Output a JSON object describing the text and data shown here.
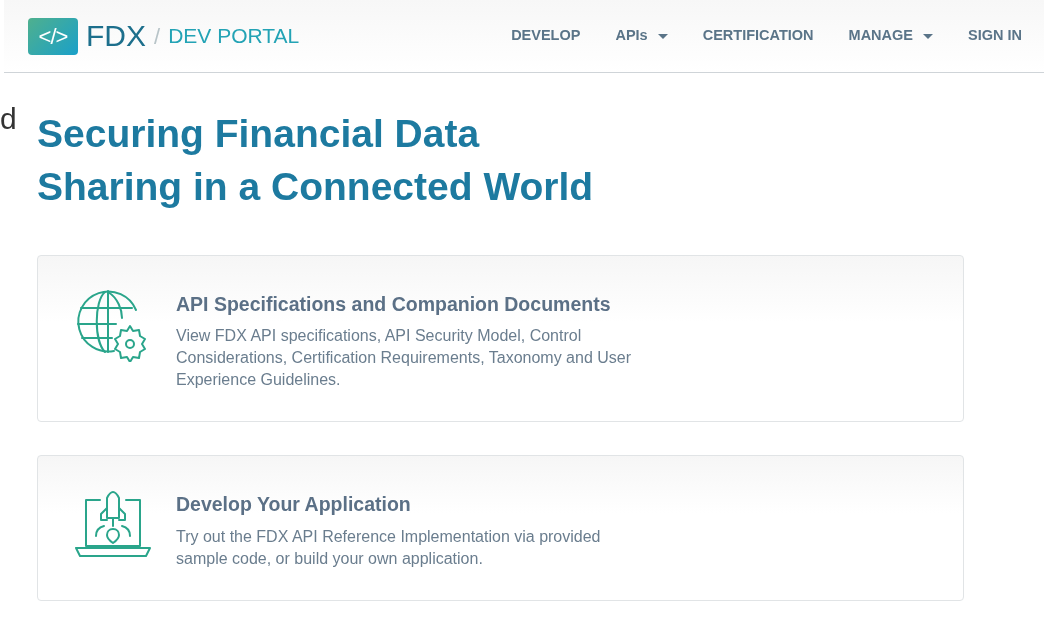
{
  "header": {
    "brand": "FDX",
    "separator": "/",
    "portal": "DEV PORTAL",
    "logo_glyph": "</>",
    "nav": [
      {
        "label": "DEVELOP",
        "dropdown": false
      },
      {
        "label": "APIs",
        "dropdown": true
      },
      {
        "label": "CERTIFICATION",
        "dropdown": false
      },
      {
        "label": "MANAGE",
        "dropdown": true
      },
      {
        "label": "SIGN IN",
        "dropdown": false
      }
    ]
  },
  "edge_text": "d",
  "hero": {
    "title_lines": [
      "Securing Financial Data",
      "Sharing in a Connected World"
    ]
  },
  "cards": [
    {
      "kind": "globe",
      "title": "API Specifications and Companion Documents",
      "text": "View FDX API specifications, API Security Model, Control Considerations, Certification Requirements, Taxonomy and User Experience Guidelines."
    },
    {
      "kind": "rocket",
      "title": "Develop Your Application",
      "text": "Try out the FDX API Reference Implementation via provided sample code, or build your own application."
    }
  ]
}
